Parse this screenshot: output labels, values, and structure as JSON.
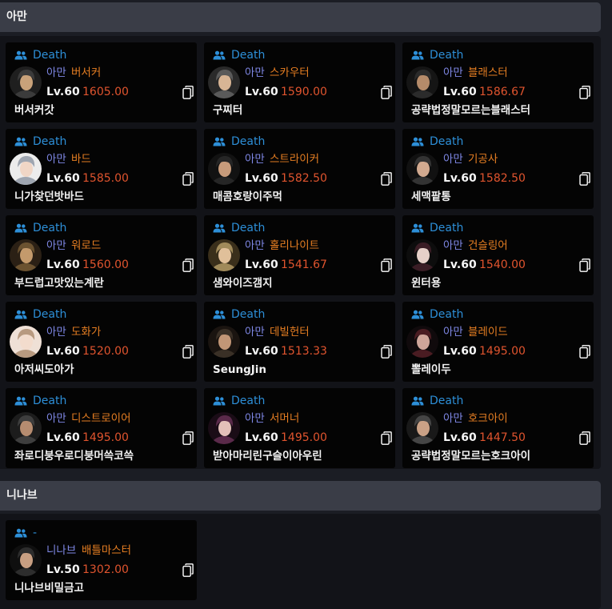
{
  "sections": [
    {
      "title": "아만",
      "cards": [
        {
          "guild": "Death",
          "server": "아만",
          "class": "버서커",
          "level": "Lv.60",
          "item_level": "1605.00",
          "name": "버서커갓"
        },
        {
          "guild": "Death",
          "server": "아만",
          "class": "스카우터",
          "level": "Lv.60",
          "item_level": "1590.00",
          "name": "구찌터"
        },
        {
          "guild": "Death",
          "server": "아만",
          "class": "블래스터",
          "level": "Lv.60",
          "item_level": "1586.67",
          "name": "공략법정말모르는블래스터"
        },
        {
          "guild": "Death",
          "server": "아만",
          "class": "바드",
          "level": "Lv.60",
          "item_level": "1585.00",
          "name": "니가찾던밧바드"
        },
        {
          "guild": "Death",
          "server": "아만",
          "class": "스트라이커",
          "level": "Lv.60",
          "item_level": "1582.50",
          "name": "매콤호랑이주먹"
        },
        {
          "guild": "Death",
          "server": "아만",
          "class": "기공사",
          "level": "Lv.60",
          "item_level": "1582.50",
          "name": "세맥팥통"
        },
        {
          "guild": "Death",
          "server": "아만",
          "class": "워로드",
          "level": "Lv.60",
          "item_level": "1560.00",
          "name": "부드럽고맛있는계란"
        },
        {
          "guild": "Death",
          "server": "아만",
          "class": "홀리나이트",
          "level": "Lv.60",
          "item_level": "1541.67",
          "name": "샘와이즈갬지"
        },
        {
          "guild": "Death",
          "server": "아만",
          "class": "건슬링어",
          "level": "Lv.60",
          "item_level": "1540.00",
          "name": "윈터용"
        },
        {
          "guild": "Death",
          "server": "아만",
          "class": "도화가",
          "level": "Lv.60",
          "item_level": "1520.00",
          "name": "아저씨도아가"
        },
        {
          "guild": "Death",
          "server": "아만",
          "class": "데빌헌터",
          "level": "Lv.60",
          "item_level": "1513.33",
          "name": "SeungJin"
        },
        {
          "guild": "Death",
          "server": "아만",
          "class": "블레이드",
          "level": "Lv.60",
          "item_level": "1495.00",
          "name": "뽈레이두"
        },
        {
          "guild": "Death",
          "server": "아만",
          "class": "디스트로이어",
          "level": "Lv.60",
          "item_level": "1495.00",
          "name": "좌로디붕우로디붕머쓱코쓱"
        },
        {
          "guild": "Death",
          "server": "아만",
          "class": "서머너",
          "level": "Lv.60",
          "item_level": "1495.00",
          "name": "받아마리린구슬이아우린"
        },
        {
          "guild": "Death",
          "server": "아만",
          "class": "호크아이",
          "level": "Lv.60",
          "item_level": "1447.50",
          "name": "공략법정말모르는호크아이"
        }
      ]
    },
    {
      "title": "니나브",
      "cards": [
        {
          "guild": "-",
          "server": "니나브",
          "class": "배틀마스터",
          "level": "Lv.50",
          "item_level": "1302.00",
          "name": "니나브비밀금고"
        }
      ]
    }
  ],
  "colors": {
    "guild": "#2d8fd8",
    "server": "#7f88e6",
    "class": "#e67e22",
    "item_level": "#e0542e"
  },
  "icons": {
    "guild": "users-icon",
    "copy": "copy-icon"
  }
}
